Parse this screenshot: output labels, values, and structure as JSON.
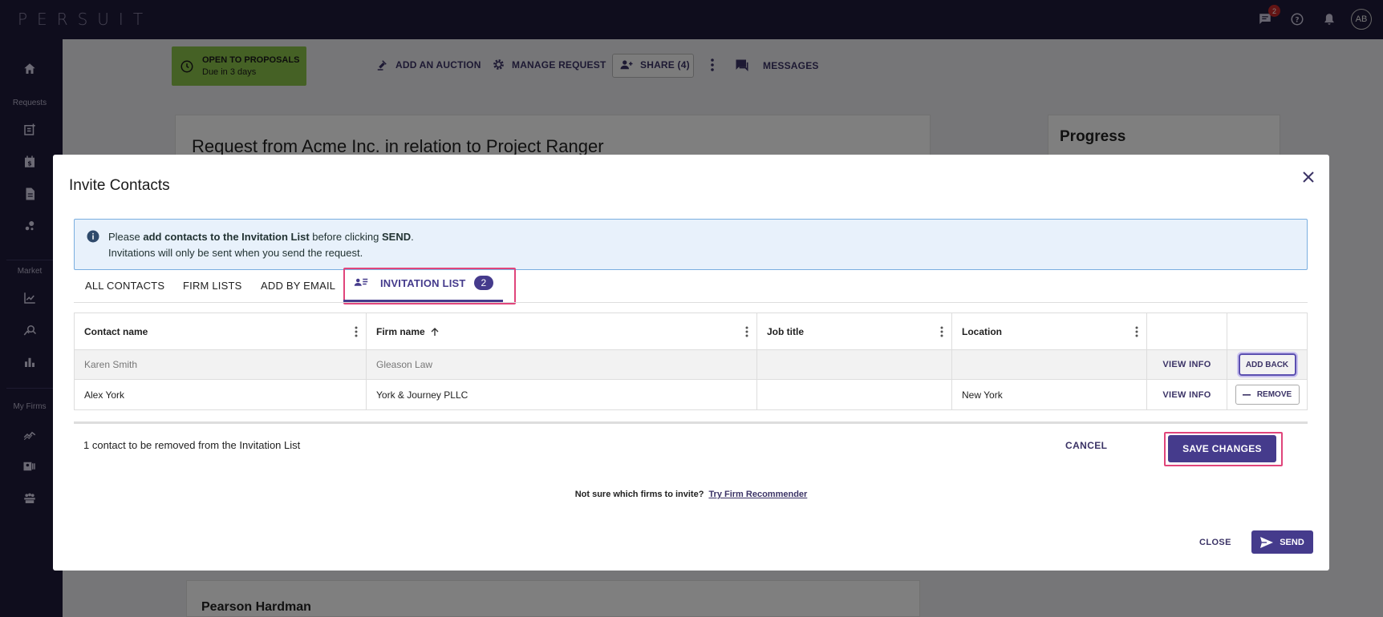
{
  "app": {
    "logo": "PERSUIT",
    "user_initials": "AB",
    "messages_badge": "2"
  },
  "sidebar": {
    "sections": [
      "Requests",
      "Market",
      "My Firms"
    ]
  },
  "request": {
    "status_title": "OPEN TO PROPOSALS",
    "status_due": "Due in 3 days",
    "actions": {
      "auction": "ADD AN AUCTION",
      "manage": "MANAGE REQUEST",
      "share": "SHARE (4)",
      "messages": "MESSAGES"
    },
    "title": "Request from Acme Inc. in relation to Project Ranger",
    "progress_title": "Progress",
    "firm_name": "Pearson Hardman"
  },
  "modal": {
    "title": "Invite Contacts",
    "info": {
      "pre": "Please ",
      "bold1": "add contacts to the Invitation List",
      "mid": " before clicking ",
      "bold2": "SEND",
      "end": ".",
      "line2": "Invitations will only be sent when you send the request."
    },
    "tabs": {
      "all": "ALL CONTACTS",
      "firm_lists": "FIRM LISTS",
      "by_email": "ADD BY EMAIL",
      "invitation": "INVITATION LIST",
      "invitation_count": "2"
    },
    "table": {
      "headers": {
        "contact": "Contact name",
        "firm": "Firm name",
        "job": "Job title",
        "location": "Location"
      },
      "rows": [
        {
          "contact": "Karen Smith",
          "firm": "Gleason Law",
          "job": "",
          "location": "",
          "view": "VIEW INFO",
          "action": "ADD BACK"
        },
        {
          "contact": "Alex York",
          "firm": "York & Journey PLLC",
          "job": "",
          "location": "New York",
          "view": "VIEW INFO",
          "action": "REMOVE"
        }
      ]
    },
    "footer": {
      "message": "1 contact to be removed from the Invitation List",
      "cancel": "CANCEL",
      "save": "SAVE CHANGES"
    },
    "recommender": {
      "question": "Not sure which firms to invite?",
      "link": "Try Firm Recommender"
    },
    "close": "CLOSE",
    "send": "SEND"
  }
}
